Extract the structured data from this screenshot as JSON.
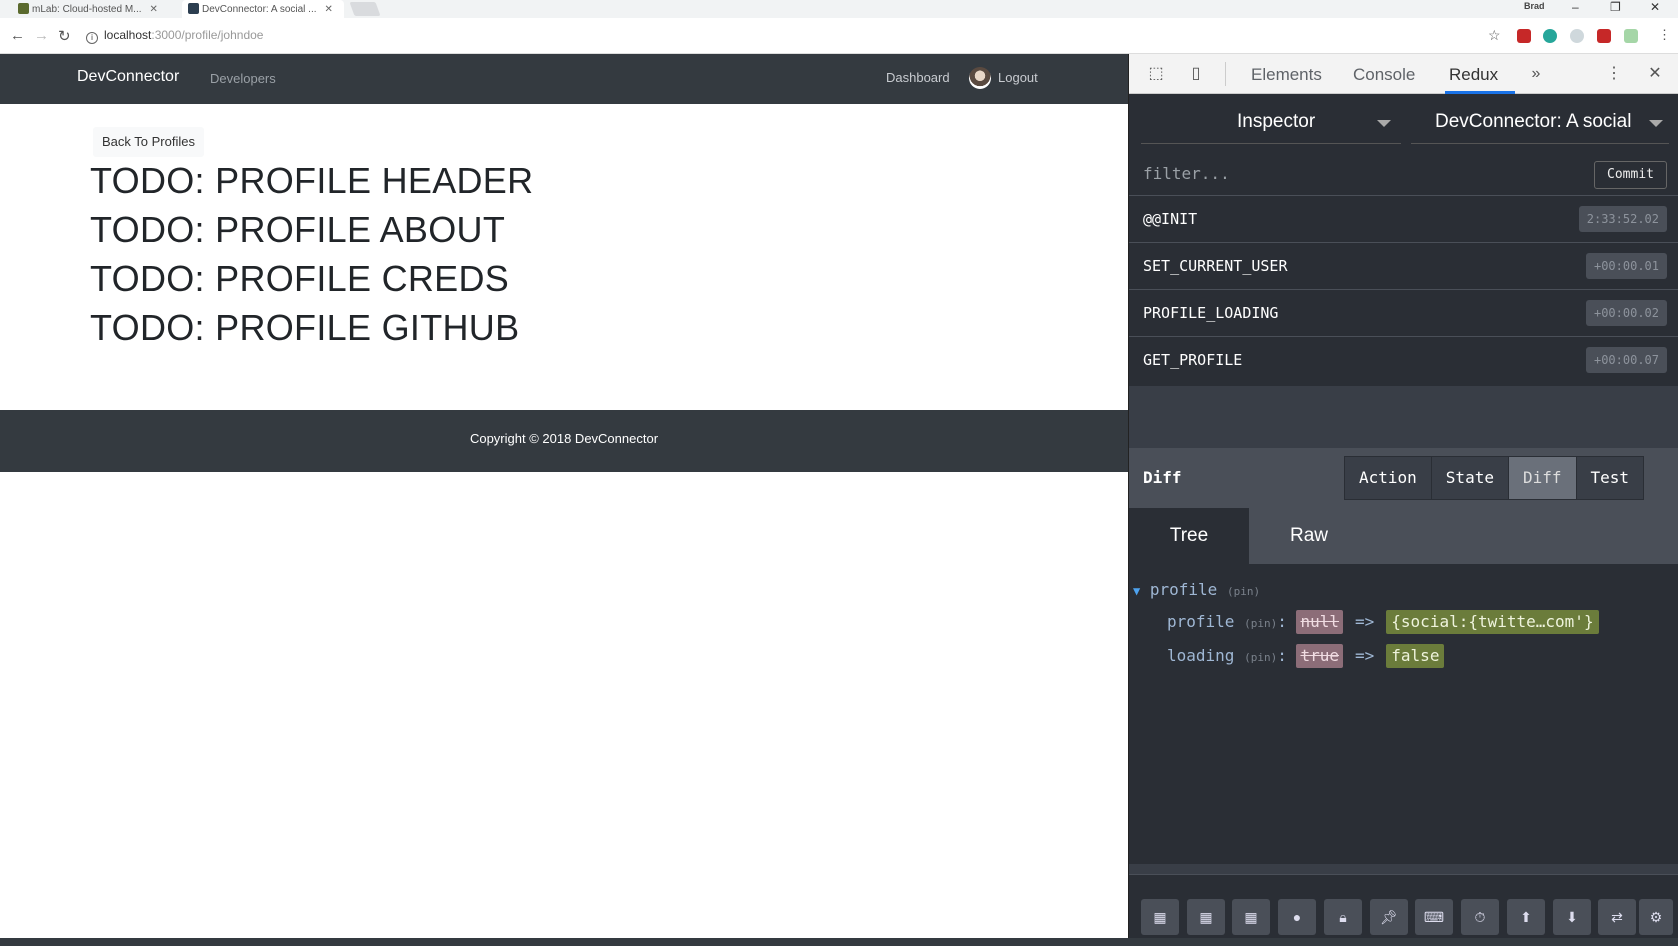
{
  "browser": {
    "tabs": [
      {
        "title": "mLab: Cloud-hosted M..."
      },
      {
        "title": "DevConnector: A social ..."
      }
    ],
    "user_label": "Brad",
    "url_host": "localhost",
    "url_path": ":3000/profile/johndoe"
  },
  "navbar": {
    "brand": "DevConnector",
    "developers": "Developers",
    "dashboard": "Dashboard",
    "logout": "Logout"
  },
  "page": {
    "back_button": "Back To Profiles",
    "todos": [
      "TODO: PROFILE HEADER",
      "TODO: PROFILE ABOUT",
      "TODO: PROFILE CREDS",
      "TODO: PROFILE GITHUB"
    ]
  },
  "footer": {
    "copyright": "Copyright © 2018 DevConnector"
  },
  "devtools": {
    "tabs": [
      "Elements",
      "Console",
      "Redux"
    ],
    "active_tab": "Redux",
    "inspector_label": "Inspector",
    "instance_label": "DevConnector: A social",
    "filter_placeholder": "filter...",
    "commit_label": "Commit",
    "actions": [
      {
        "name": "@@INIT",
        "time": "2:33:52.02"
      },
      {
        "name": "SET_CURRENT_USER",
        "time": "+00:00.01"
      },
      {
        "name": "PROFILE_LOADING",
        "time": "+00:00.02"
      },
      {
        "name": "GET_PROFILE",
        "time": "+00:00.07"
      }
    ],
    "diff_title": "Diff",
    "monitor_buttons": [
      "Action",
      "State",
      "Diff",
      "Test"
    ],
    "active_monitor": "Diff",
    "tree_tabs": [
      "Tree",
      "Raw"
    ],
    "active_tree_tab": "Tree",
    "tree": {
      "root_key": "profile",
      "pin": "(pin)",
      "rows": [
        {
          "key": "profile",
          "old": "null",
          "new": "{social:{twitte…com'}"
        },
        {
          "key": "loading",
          "old": "true",
          "new": "false"
        }
      ],
      "arrow": "=>"
    },
    "bottom_icons": [
      "layout-icon",
      "layout-icon",
      "layout-icon",
      "record-icon",
      "lock-icon",
      "pin-icon",
      "keyboard-icon",
      "timer-icon",
      "upload-icon",
      "download-icon",
      "remote-icon",
      "settings-icon"
    ]
  },
  "colors": {
    "navbar_bg": "#343a40",
    "devtools_bg": "#2a2e35",
    "diff_removed": "#8c6d78",
    "diff_added": "#6b7c3b",
    "active_tab_underline": "#1a73e8"
  }
}
